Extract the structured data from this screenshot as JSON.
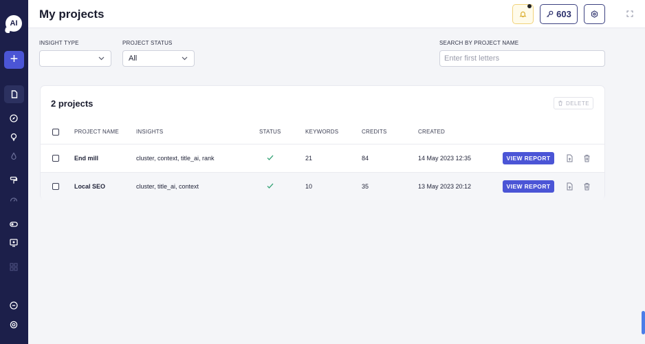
{
  "logo": {
    "text": "AI"
  },
  "header": {
    "title": "My projects",
    "credits": "603"
  },
  "filters": {
    "insight_type": {
      "label": "INSIGHT TYPE",
      "value": ""
    },
    "project_status": {
      "label": "PROJECT STATUS",
      "value": "All"
    },
    "search": {
      "label": "SEARCH BY PROJECT NAME",
      "placeholder": "Enter first letters",
      "value": ""
    }
  },
  "projects": {
    "count_title": "2 projects",
    "delete_label": "DELETE",
    "columns": [
      "PROJECT NAME",
      "INSIGHTS",
      "STATUS",
      "KEYWORDS",
      "CREDITS",
      "CREATED"
    ],
    "rows": [
      {
        "name": "End mill",
        "insights": "cluster, context, title_ai, rank",
        "keywords": "21",
        "credits": "84",
        "created": "14 May 2023 12:35",
        "action": "VIEW REPORT"
      },
      {
        "name": "Local SEO",
        "insights": "cluster, title_ai, context",
        "keywords": "10",
        "credits": "35",
        "created": "13 May 2023 20:12",
        "action": "VIEW REPORT"
      }
    ]
  },
  "colors": {
    "sidebar": "#1c1f4a",
    "accent": "#4b55d6",
    "status_ok": "#3aa57a",
    "bell_border": "#f1d27a"
  },
  "icons": {
    "sidebar": [
      "plus-icon",
      "document-icon",
      "compass-icon",
      "lightbulb-icon",
      "drop-icon",
      "paint-roller-icon",
      "gauge-icon",
      "toggle-icon",
      "monitor-icon",
      "grid-icon",
      "link-icon",
      "gear-icon"
    ],
    "header": [
      "bell-icon",
      "key-icon",
      "settings-icon",
      "expand-icon"
    ],
    "row": [
      "checkmark-icon",
      "export-icon",
      "trash-icon"
    ]
  }
}
